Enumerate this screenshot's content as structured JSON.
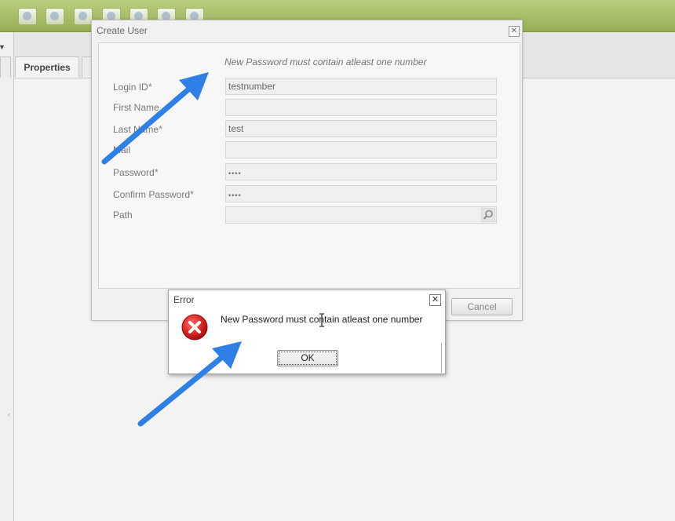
{
  "background": {
    "tabs": [
      {
        "label": "Properties"
      }
    ]
  },
  "create_user_dialog": {
    "title": "Create User",
    "close_label": "✕",
    "validation_message": "New Password must contain atleast one number",
    "fields": [
      {
        "label": "Login ID",
        "required": true,
        "value": "testnumber"
      },
      {
        "label": "First Name",
        "required": false,
        "value": ""
      },
      {
        "label": "Last Name",
        "required": true,
        "value": "test"
      },
      {
        "label": "Mail",
        "required": false,
        "value": ""
      },
      {
        "label": "Password",
        "required": true,
        "value": "••••"
      },
      {
        "label": "Confirm Password",
        "required": true,
        "value": "••••"
      },
      {
        "label": "Path",
        "required": false,
        "value": ""
      }
    ],
    "required_marker": "*",
    "cancel_label": "Cancel"
  },
  "error_dialog": {
    "title": "Error",
    "close_label": "✕",
    "message": "New Password must contain atleast one number",
    "ok_label": "OK"
  },
  "colors": {
    "toolbar": "#a6bd62",
    "annotation_arrow": "#2f7fe6",
    "error_icon": "#d21f1f"
  }
}
